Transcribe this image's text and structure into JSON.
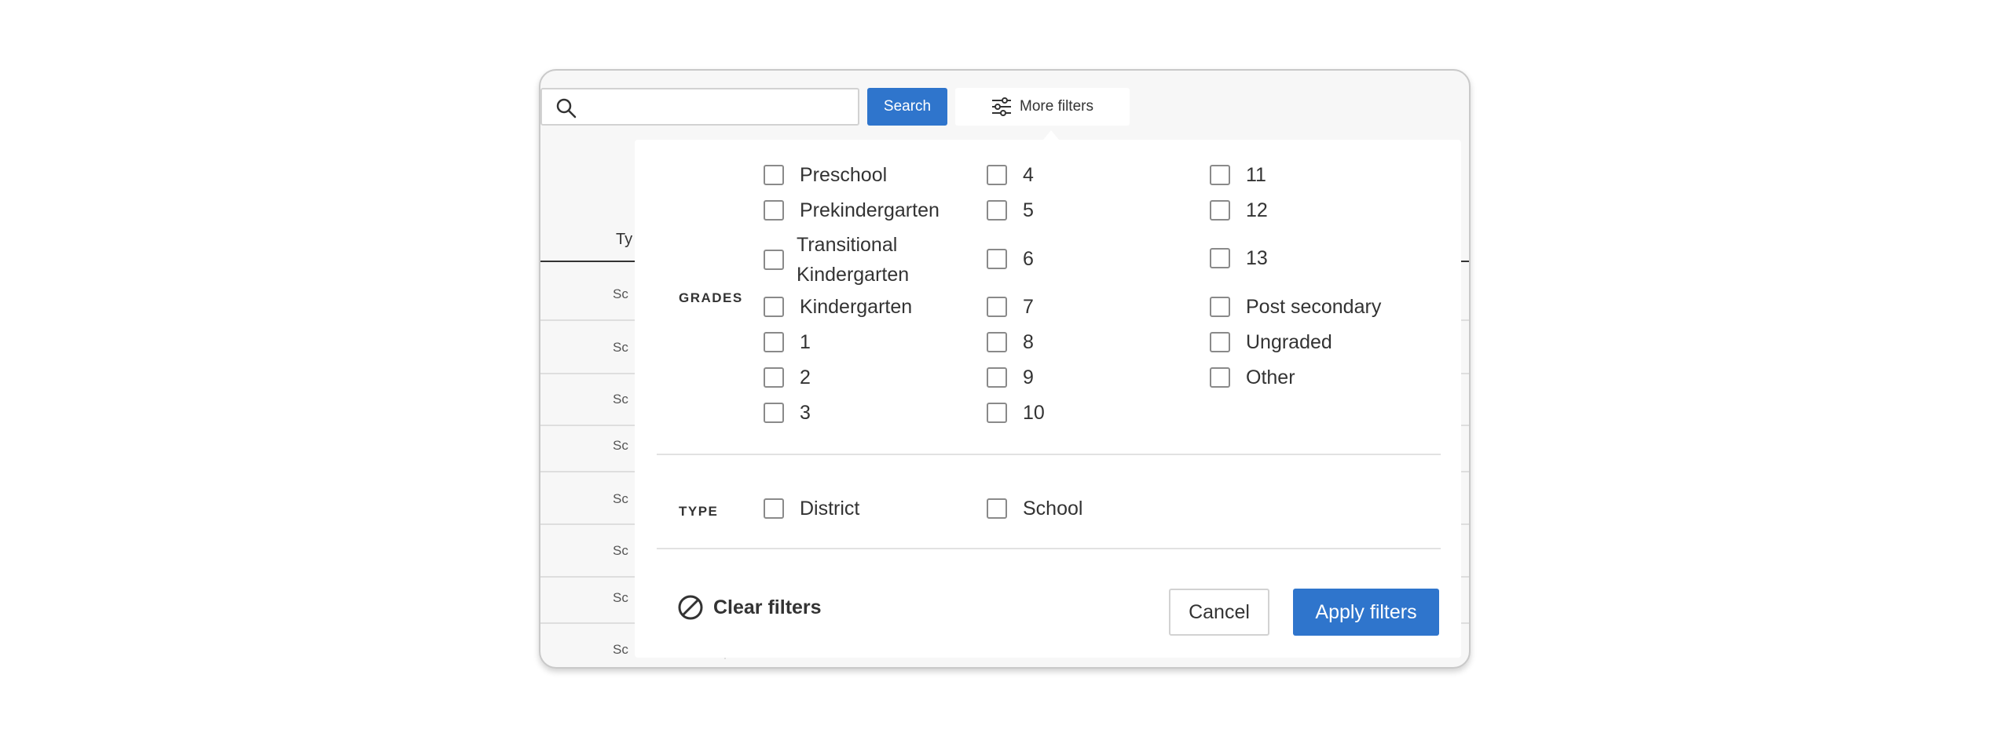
{
  "toolbar": {
    "search_value": "",
    "search_label": "Search",
    "more_filters_label": "More filters"
  },
  "table": {
    "type_header": "Ty",
    "row_cell": "Sc"
  },
  "filters": {
    "grades_label": "GRADES",
    "grades": [
      [
        "Preschool",
        "Prekindergarten",
        "Transitional Kindergarten",
        "Kindergarten",
        "1",
        "2",
        "3"
      ],
      [
        "4",
        "5",
        "6",
        "7",
        "8",
        "9",
        "10"
      ],
      [
        "11",
        "12",
        "13",
        "Post secondary",
        "Ungraded",
        "Other"
      ]
    ],
    "type_label": "TYPE",
    "types": [
      "District",
      "School"
    ],
    "clear_label": "Clear filters",
    "cancel_label": "Cancel",
    "apply_label": "Apply filters"
  },
  "colors": {
    "accent": "#2f75cc"
  }
}
